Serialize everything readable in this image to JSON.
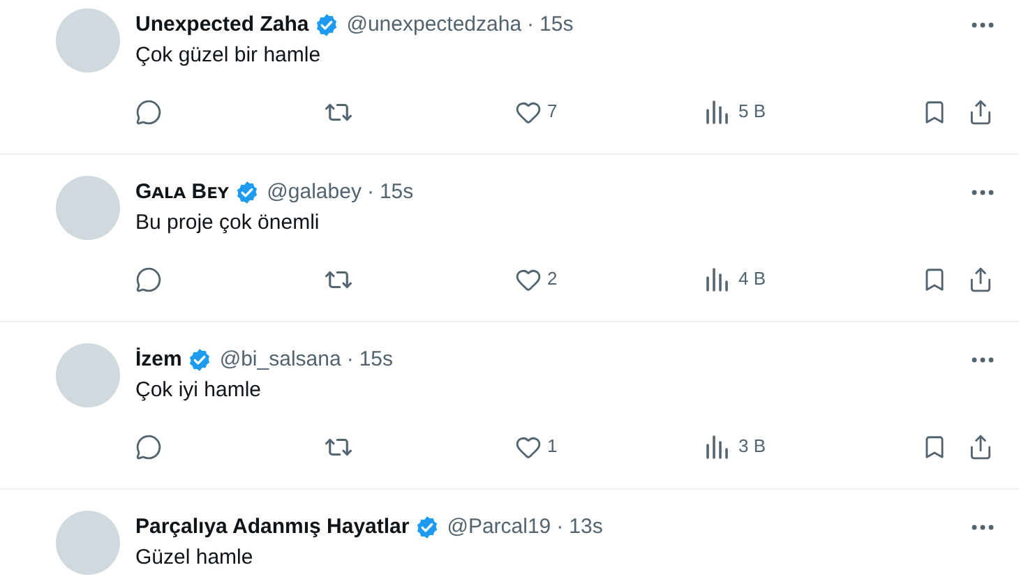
{
  "tweets": [
    {
      "name": "Unexpected Zaha",
      "verified": true,
      "handle": "@unexpectedzaha",
      "separator": "·",
      "time": "15s",
      "text": "Çok güzel bir hamle",
      "stats": {
        "likes": "7",
        "views": "5 B"
      }
    },
    {
      "name": "Gᴀʟᴀ Bᴇʏ",
      "verified": true,
      "handle": "@galabey",
      "separator": "·",
      "time": "15s",
      "text": "Bu proje çok önemli",
      "stats": {
        "likes": "2",
        "views": "4 B"
      }
    },
    {
      "name": "İzem",
      "verified": true,
      "handle": "@bi_salsana",
      "separator": "·",
      "time": "15s",
      "text": "Çok iyi hamle",
      "stats": {
        "likes": "1",
        "views": "3 B"
      }
    },
    {
      "name": "Parçalıya Adanmış Hayatlar",
      "verified": true,
      "handle": "@Parcal19",
      "separator": "·",
      "time": "13s",
      "text": "Güzel hamle"
    }
  ]
}
